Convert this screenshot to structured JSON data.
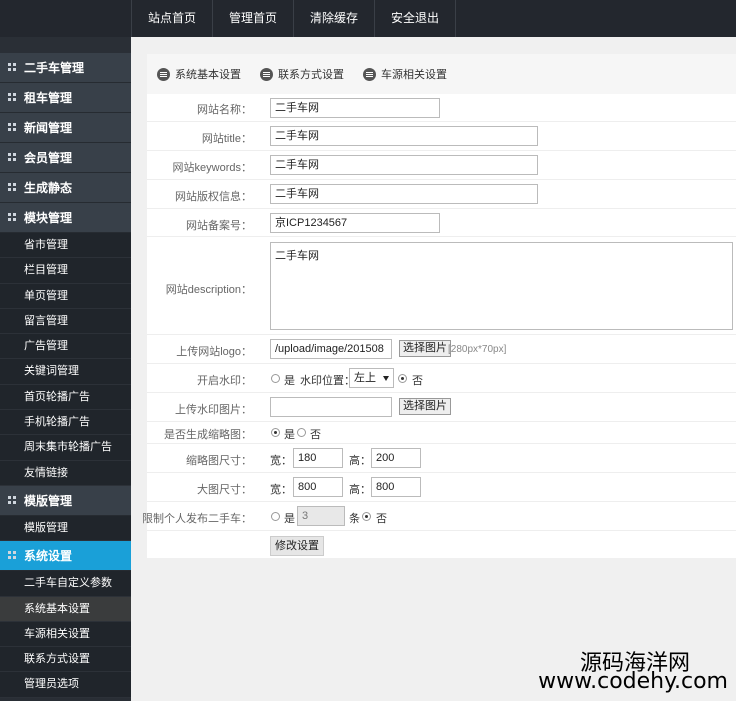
{
  "topnav": [
    "站点首页",
    "管理首页",
    "清除缓存",
    "安全退出"
  ],
  "sidebar": [
    {
      "label": "二手车管理",
      "type": "group"
    },
    {
      "label": "租车管理",
      "type": "group"
    },
    {
      "label": "新闻管理",
      "type": "group"
    },
    {
      "label": "会员管理",
      "type": "group"
    },
    {
      "label": "生成静态",
      "type": "group"
    },
    {
      "label": "模块管理",
      "type": "group"
    },
    {
      "label": "省市管理",
      "type": "sub"
    },
    {
      "label": "栏目管理",
      "type": "sub"
    },
    {
      "label": "单页管理",
      "type": "sub"
    },
    {
      "label": "留言管理",
      "type": "sub"
    },
    {
      "label": "广告管理",
      "type": "sub"
    },
    {
      "label": "关键词管理",
      "type": "sub"
    },
    {
      "label": "首页轮播广告",
      "type": "sub"
    },
    {
      "label": "手机轮播广告",
      "type": "sub"
    },
    {
      "label": "周末集市轮播广告",
      "type": "sub"
    },
    {
      "label": "友情链接",
      "type": "sub"
    },
    {
      "label": "模版管理",
      "type": "group"
    },
    {
      "label": "模版管理",
      "type": "sub"
    },
    {
      "label": "系统设置",
      "type": "group",
      "active": true
    },
    {
      "label": "二手车自定义参数",
      "type": "sub"
    },
    {
      "label": "系统基本设置",
      "type": "sub",
      "active": true
    },
    {
      "label": "车源相关设置",
      "type": "sub"
    },
    {
      "label": "联系方式设置",
      "type": "sub"
    },
    {
      "label": "管理员选项",
      "type": "sub"
    }
  ],
  "tabs": [
    "系统基本设置",
    "联系方式设置",
    "车源相关设置"
  ],
  "form": {
    "site_name_label": "网站名称：",
    "site_name": "二手车网",
    "title_label": "网站title：",
    "title": "二手车网",
    "keywords_label": "网站keywords：",
    "keywords": "二手车网",
    "copyright_label": "网站版权信息：",
    "copyright": "二手车网",
    "icp_label": "网站备案号：",
    "icp": "京ICP1234567",
    "desc_label": "网站description：",
    "desc": "二手车网",
    "logo_label": "上传网站logo：",
    "logo_path": "/upload/image/201508",
    "choose_image": "选择图片",
    "logo_hint": "[280px*70px]",
    "watermark_label": "开启水印：",
    "yes": "是",
    "no": "否",
    "watermark_pos_label": "水印位置：",
    "watermark_pos": "左上",
    "watermark_img_label": "上传水印图片：",
    "thumb_label": "是否生成缩略图：",
    "thumb_size_label": "缩略图尺寸：",
    "width_label": "宽：",
    "height_label": "高：",
    "thumb_w": "180",
    "thumb_h": "200",
    "big_size_label": "大图尺寸：",
    "big_w": "800",
    "big_h": "800",
    "limit_label": "限制个人发布二手车：",
    "limit_value": "3",
    "limit_unit": "条",
    "submit": "修改设置"
  },
  "watermark": {
    "line1": "源码海洋网",
    "line2": "www.codehy.com"
  }
}
